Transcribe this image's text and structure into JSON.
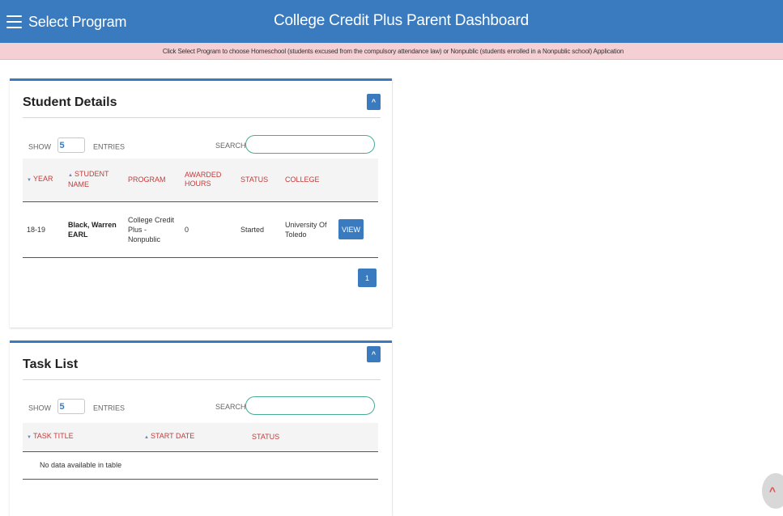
{
  "header": {
    "menu_label": "Select Program",
    "title": "College Credit Plus Parent Dashboard",
    "menu_icon": "hamburger-menu-icon"
  },
  "notice": {
    "text": "Click Select Program to choose Homeschool (students excused from the compulsory attendance law) or Nonpublic (students enrolled in a Nonpublic school) Application"
  },
  "colors": {
    "brand": "#3a7bbf",
    "notice_background": "#f4cfd3",
    "column_header_text": "#c43b3b",
    "search_border": "#47ad94"
  },
  "student_details": {
    "title": "Student Details",
    "collapse_icon": "chevron-up-icon",
    "show_label": "SHOW",
    "show_value": "5",
    "entries_label": "ENTRIES",
    "search_label": "SEARCH:",
    "search_value": "",
    "columns": [
      "YEAR",
      "STUDENT NAME",
      "PROGRAM",
      "AWARDED HOURS",
      "STATUS",
      "COLLEGE"
    ],
    "sort_icons": {
      "year": "sort-descending-icon",
      "student_name": "sort-ascending-icon"
    },
    "rows": [
      {
        "year": "18-19",
        "student_name": "Black, Warren EARL",
        "program": "College Credit Plus - Nonpublic",
        "awarded_hours": "0",
        "status": "Started",
        "college": "University Of Toledo",
        "action_label": "VIEW"
      }
    ],
    "pagination": {
      "current_page": "1"
    }
  },
  "task_list": {
    "title": "Task List",
    "collapse_icon": "chevron-up-icon",
    "show_label": "SHOW",
    "show_value": "5",
    "entries_label": "ENTRIES",
    "search_label": "SEARCH:",
    "search_value": "",
    "columns": [
      "TASK TITLE",
      "START DATE",
      "STATUS"
    ],
    "sort_icons": {
      "task_title": "sort-descending-icon",
      "start_date": "sort-ascending-icon"
    },
    "empty_message": "No data available in table"
  },
  "scroll_top": {
    "icon": "chevron-up-icon"
  }
}
